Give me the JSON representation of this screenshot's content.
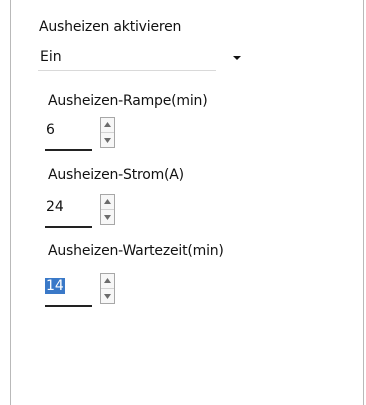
{
  "sections": {
    "enable_label": "Ausheizen aktivieren",
    "enable_value": "Ein",
    "ramp_label": "Ausheizen-Rampe(min)",
    "ramp_value": "6",
    "current_label": "Ausheizen-Strom(A)",
    "current_value": "24",
    "wait_label": "Ausheizen-Wartezeit(min)",
    "wait_value": "14"
  },
  "icons": {
    "dropdown": "dropdown-arrow-icon",
    "spin_up": "spin-up-icon",
    "spin_down": "spin-down-icon"
  },
  "colors": {
    "selection": "#3a79c8"
  }
}
